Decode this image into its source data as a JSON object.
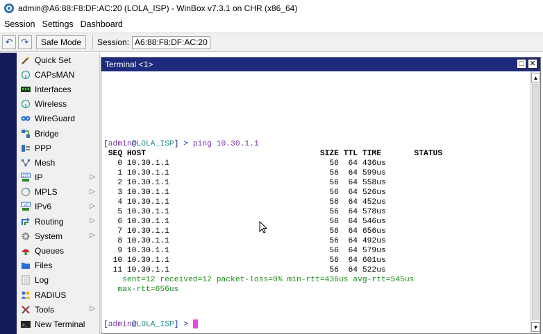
{
  "window": {
    "title": "admin@A6:88:F8:DF:AC:20 (LOLA_ISP) - WinBox v7.3.1 on CHR (x86_64)"
  },
  "menu": [
    "Session",
    "Settings",
    "Dashboard"
  ],
  "toolbar": {
    "undo_icon": "undo-icon",
    "redo_icon": "redo-icon",
    "safe_mode_label": "Safe Mode",
    "session_label": "Session:",
    "session_value": "A6:88:F8:DF:AC:20"
  },
  "sidebar": {
    "items": [
      {
        "label": "Quick Set",
        "icon": "wand-icon",
        "arrow": false
      },
      {
        "label": "CAPsMAN",
        "icon": "antenna-icon",
        "arrow": false
      },
      {
        "label": "Interfaces",
        "icon": "interfaces-icon",
        "arrow": false
      },
      {
        "label": "Wireless",
        "icon": "antenna-icon",
        "arrow": false
      },
      {
        "label": "WireGuard",
        "icon": "wireguard-icon",
        "arrow": false
      },
      {
        "label": "Bridge",
        "icon": "bridge-icon",
        "arrow": false
      },
      {
        "label": "PPP",
        "icon": "ppp-icon",
        "arrow": false
      },
      {
        "label": "Mesh",
        "icon": "mesh-icon",
        "arrow": false
      },
      {
        "label": "IP",
        "icon": "ip-icon",
        "arrow": true
      },
      {
        "label": "MPLS",
        "icon": "mpls-icon",
        "arrow": true
      },
      {
        "label": "IPv6",
        "icon": "ipv6-icon",
        "arrow": true
      },
      {
        "label": "Routing",
        "icon": "routing-icon",
        "arrow": true
      },
      {
        "label": "System",
        "icon": "gear-icon",
        "arrow": true
      },
      {
        "label": "Queues",
        "icon": "queues-icon",
        "arrow": false
      },
      {
        "label": "Files",
        "icon": "folder-icon",
        "arrow": false
      },
      {
        "label": "Log",
        "icon": "log-icon",
        "arrow": false
      },
      {
        "label": "RADIUS",
        "icon": "radius-icon",
        "arrow": false
      },
      {
        "label": "Tools",
        "icon": "tools-icon",
        "arrow": true
      },
      {
        "label": "New Terminal",
        "icon": "terminal-icon",
        "arrow": false
      }
    ]
  },
  "terminal": {
    "title": "Terminal <1>",
    "prompt": {
      "open": "[",
      "user": "admin",
      "at": "@",
      "host": "LOLA_ISP",
      "close": "] > "
    },
    "command": "ping 10.30.1.1",
    "header": " SEQ HOST                                     SIZE TTL TIME       STATUS",
    "rows": [
      "   0 10.30.1.1                                  56  64 436us",
      "   1 10.30.1.1                                  56  64 599us",
      "   2 10.30.1.1                                  56  64 558us",
      "   3 10.30.1.1                                  56  64 526us",
      "   4 10.30.1.1                                  56  64 452us",
      "   5 10.30.1.1                                  56  64 578us",
      "   6 10.30.1.1                                  56  64 546us",
      "   7 10.30.1.1                                  56  64 656us",
      "   8 10.30.1.1                                  56  64 492us",
      "   9 10.30.1.1                                  56  64 579us",
      "  10 10.30.1.1                                  56  64 601us",
      "  11 10.30.1.1                                  56  64 522us"
    ],
    "summary1": "    sent=12 received=12 packet-loss=0% min-rtt=436us avg-rtt=545us",
    "summary2": "   max-rtt=656us"
  },
  "colors": {
    "terminal_title_bg": "#1e2b7d",
    "left_strip": "#161c5a",
    "prompt_user": "#7a2da0",
    "prompt_host": "#1a8a8a",
    "summary": "#1a8a1a",
    "cursor": "#ee44dd"
  }
}
